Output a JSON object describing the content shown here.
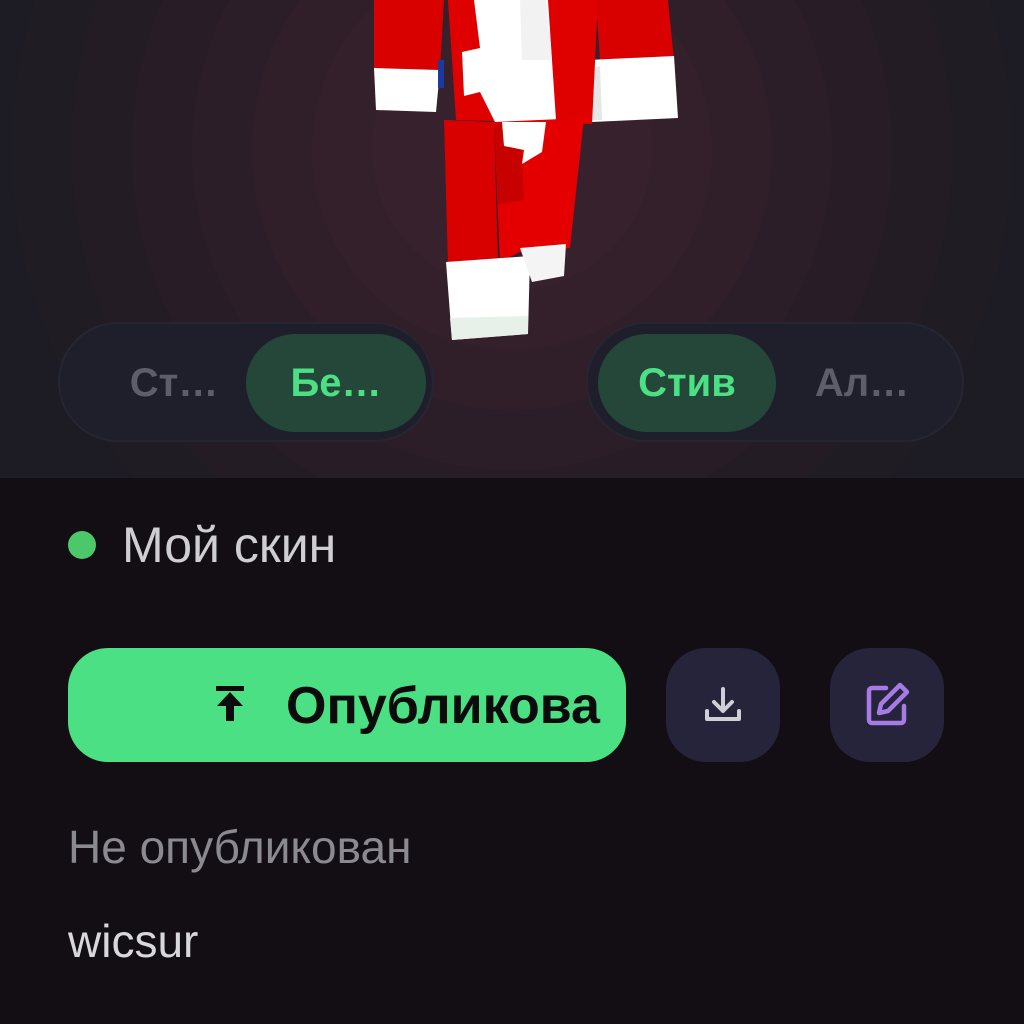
{
  "preview": {
    "model_toggle": {
      "options": [
        {
          "label": "Ст…",
          "active": false
        },
        {
          "label": "Бе…",
          "active": true
        }
      ]
    },
    "body_toggle": {
      "options": [
        {
          "label": "Стив",
          "active": true
        },
        {
          "label": "Ал…",
          "active": false
        }
      ]
    }
  },
  "skin": {
    "status_label": "Мой скин",
    "status_dot_color": "#4cc86a",
    "publish_label": "Опубликова",
    "publish_icon": "upload-to-top-icon",
    "download_icon": "download-icon",
    "edit_icon": "edit-icon",
    "publish_status": "Не опубликован",
    "username": "wicsur"
  },
  "colors": {
    "accent": "#4be084",
    "edit_icon": "#a77be6",
    "background": "#130e13"
  }
}
